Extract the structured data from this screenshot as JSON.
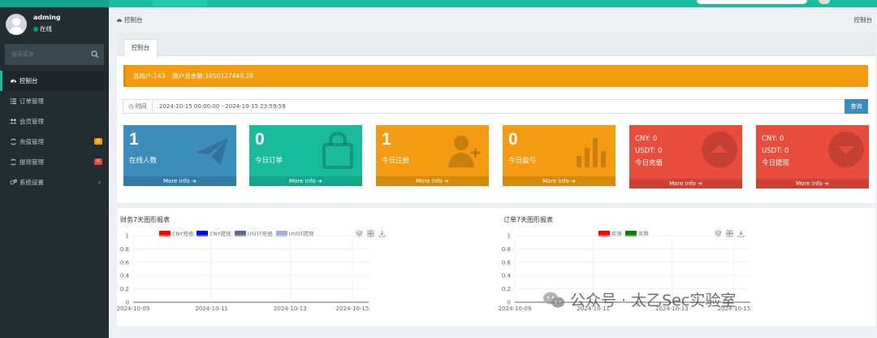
{
  "sidebar": {
    "user": {
      "name": "adming",
      "status": "在线"
    },
    "search_placeholder": "搜索菜单",
    "items": [
      {
        "label": "控制台",
        "icon": "dashboard-icon"
      },
      {
        "label": "订单管理",
        "icon": "list-icon"
      },
      {
        "label": "会员管理",
        "icon": "users-icon"
      },
      {
        "label": "充值管理",
        "icon": "recharge-icon",
        "badge": "0"
      },
      {
        "label": "提现管理",
        "icon": "withdraw-icon",
        "badge": "0"
      },
      {
        "label": "系统设置",
        "icon": "cogs-icon"
      }
    ]
  },
  "header": {
    "breadcrumb": "控制台",
    "right": "控制台"
  },
  "tabs": [
    "控制台"
  ],
  "alert": {
    "total_users": "总用户:143",
    "user_balance": "用户总余额:1050127449.28"
  },
  "filter": {
    "label": "时间",
    "range": "2024-10-15 00:00:00 - 2024-10-15 23:59:59",
    "button": "查询"
  },
  "boxes": [
    {
      "value": "1",
      "label": "在线人数",
      "more": "More info",
      "color": "#3c8dbc",
      "icon": "paper-plane-icon"
    },
    {
      "value": "0",
      "label": "今日订单",
      "more": "More info",
      "color": "#18bc9c",
      "icon": "shopping-bag-icon"
    },
    {
      "value": "1",
      "label": "今日注册",
      "more": "More info",
      "color": "#f39c12",
      "icon": "user-plus-icon"
    },
    {
      "value": "0",
      "label": "今日盈亏",
      "more": "More info",
      "color": "#f39c12",
      "icon": "bar-chart-icon"
    },
    {
      "cny": "CNY:  0",
      "usdt": "USDT:  0",
      "label": "今日充值",
      "more": "More info",
      "color": "#e74c3c",
      "icon": "arrow-up-circle-icon"
    },
    {
      "cny": "CNY:  0",
      "usdt": "USDT:  0",
      "label": "今日提现",
      "more": "More info",
      "color": "#e74c3c",
      "icon": "arrow-down-circle-icon"
    }
  ],
  "colors": {
    "accent": "#18bc9c",
    "blue": "#3c8dbc",
    "orange": "#f39c12",
    "red": "#e74c3c",
    "sidebar": "#222d32"
  },
  "chart_data": [
    {
      "type": "line",
      "title": "财务7天图形报表",
      "x": [
        "2024-10-09",
        "2024-10-11",
        "2024-10-13",
        "2024-10-15"
      ],
      "ylim": [
        0,
        1
      ],
      "yticks": [
        "1",
        "0.8",
        "0.6",
        "0.4",
        "0.2",
        "0"
      ],
      "series": [
        {
          "name": "CNY充值",
          "color": "#ff0000",
          "values": []
        },
        {
          "name": "CNY提现",
          "color": "#0000ff",
          "values": []
        },
        {
          "name": "USDT充值",
          "color": "#5b6a8c",
          "values": []
        },
        {
          "name": "USDT提现",
          "color": "#a3a8e0",
          "values": []
        }
      ],
      "legend": "top"
    },
    {
      "type": "line",
      "title": "订单7天图形报表",
      "x": [
        "2024-10-09",
        "2024-10-11",
        "2024-10-13",
        "2024-10-15"
      ],
      "ylim": [
        0,
        1
      ],
      "yticks": [
        "1",
        "0.8",
        "0.6",
        "0.4",
        "0.2",
        "0"
      ],
      "series": [
        {
          "name": "买涨",
          "color": "#ff0000",
          "values": []
        },
        {
          "name": "买跌",
          "color": "#008000",
          "values": []
        }
      ],
      "legend": "top"
    }
  ],
  "watermark": "公众号 · 太乙Sec实验室"
}
